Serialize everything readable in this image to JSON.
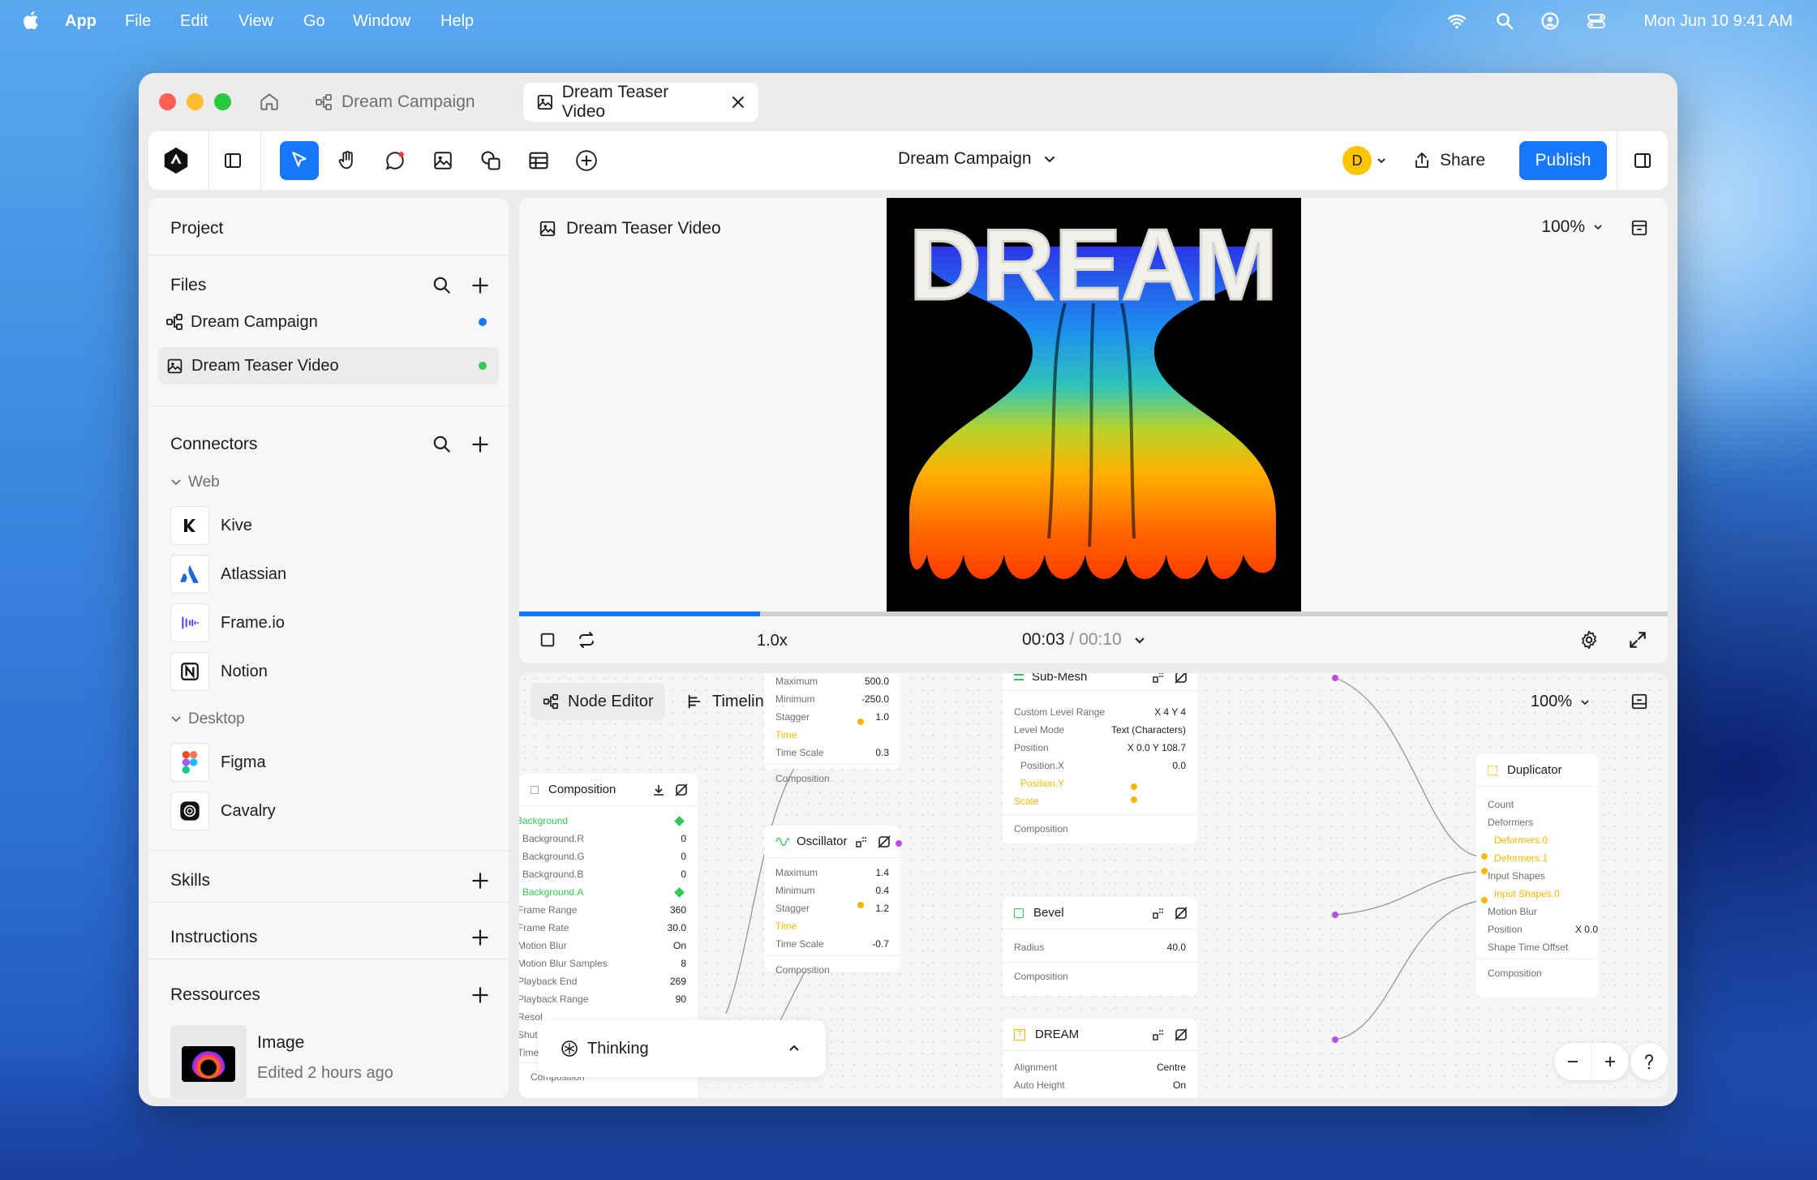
{
  "menubar": {
    "app": "App",
    "items": [
      "File",
      "Edit",
      "View",
      "Go",
      "Window",
      "Help"
    ],
    "clock": "Mon Jun 10  9:41 AM"
  },
  "tabs": {
    "tab1": "Dream Campaign",
    "tab2": "Dream Teaser Video"
  },
  "toolbar": {
    "project": "Dream Campaign",
    "avatar": "D",
    "share": "Share",
    "publish": "Publish"
  },
  "sidebar": {
    "project": "Project",
    "files_title": "Files",
    "files": [
      {
        "name": "Dream Campaign",
        "status_color": "#1677ff"
      },
      {
        "name": "Dream Teaser Video",
        "status_color": "#34c759"
      }
    ],
    "connectors_title": "Connectors",
    "web_group": "Web",
    "web": [
      "Kive",
      "Atlassian",
      "Frame.io",
      "Notion"
    ],
    "desktop_group": "Desktop",
    "desktop": [
      "Figma",
      "Cavalry"
    ],
    "skills": "Skills",
    "instructions": "Instructions",
    "resources": "Ressources",
    "resource_item": {
      "name": "Image",
      "meta": "Edited 2 hours ago"
    }
  },
  "viewer": {
    "title": "Dream Teaser Video",
    "zoom": "100%",
    "artwork_text": "DREAM",
    "speed": "1.0x",
    "time_current": "00:03",
    "time_sep": " / ",
    "time_total": "00:10",
    "progress": 0.21
  },
  "node_editor": {
    "tab1": "Node Editor",
    "tab2": "Timeline",
    "zoom": "100%",
    "thinking": "Thinking",
    "osc_top": {
      "rows": [
        [
          "Maximum",
          "500.0"
        ],
        [
          "Minimum",
          "-250.0"
        ],
        [
          "Stagger",
          "1.0"
        ],
        [
          "Time",
          ""
        ],
        [
          "Time Scale",
          "0.3"
        ]
      ],
      "footer": "Composition"
    },
    "composition": {
      "title": "Composition",
      "rows": [
        [
          "Background",
          ""
        ],
        [
          "Background.R",
          "0"
        ],
        [
          "Background.G",
          "0"
        ],
        [
          "Background.B",
          "0"
        ],
        [
          "Background.A",
          ""
        ],
        [
          "Frame Range",
          "360"
        ],
        [
          "Frame Rate",
          "30.0"
        ],
        [
          "Motion Blur",
          "On"
        ],
        [
          "Motion Blur Samples",
          "8"
        ],
        [
          "Playback End",
          "269"
        ],
        [
          "Playback Range",
          "90"
        ],
        [
          "Resol",
          ""
        ],
        [
          "Shut",
          ""
        ],
        [
          "Time",
          ""
        ]
      ],
      "footer": "Composition"
    },
    "oscillator": {
      "title": "Oscillator",
      "rows": [
        [
          "Maximum",
          "1.4"
        ],
        [
          "Minimum",
          "0.4"
        ],
        [
          "Stagger",
          "1.2"
        ],
        [
          "Time",
          ""
        ],
        [
          "Time Scale",
          "-0.7"
        ]
      ],
      "footer": "Composition"
    },
    "submesh": {
      "title": "Sub-Mesh",
      "rows": [
        [
          "Custom Level Range",
          "X 4  Y 4"
        ],
        [
          "Level Mode",
          "Text (Characters)"
        ],
        [
          "Position",
          "X 0.0  Y 108.7"
        ],
        [
          "Position.X",
          "0.0"
        ],
        [
          "Position.Y",
          ""
        ],
        [
          "Scale",
          ""
        ]
      ],
      "footer": "Composition"
    },
    "bevel": {
      "title": "Bevel",
      "rows": [
        [
          "Radius",
          "40.0"
        ]
      ],
      "footer": "Composition"
    },
    "dream": {
      "title": "DREAM",
      "rows": [
        [
          "Alignment",
          "Centre"
        ],
        [
          "Auto Height",
          "On"
        ]
      ]
    },
    "duplicator": {
      "title": "Duplicator",
      "rows": [
        [
          "Count",
          ""
        ],
        [
          "Deformers",
          ""
        ],
        [
          "Deformers.0",
          ""
        ],
        [
          "Deformers.1",
          ""
        ],
        [
          "Input Shapes",
          ""
        ],
        [
          "Input Shapes.0",
          ""
        ],
        [
          "Motion Blur",
          ""
        ],
        [
          "Position",
          "X 0.0"
        ],
        [
          "Shape Time Offset",
          ""
        ]
      ],
      "footer": "Composition"
    }
  },
  "colors": {
    "accent": "#1677ff",
    "port_yellow": "#f5b800",
    "port_purple": "#b84ee6",
    "green": "#34c759"
  }
}
